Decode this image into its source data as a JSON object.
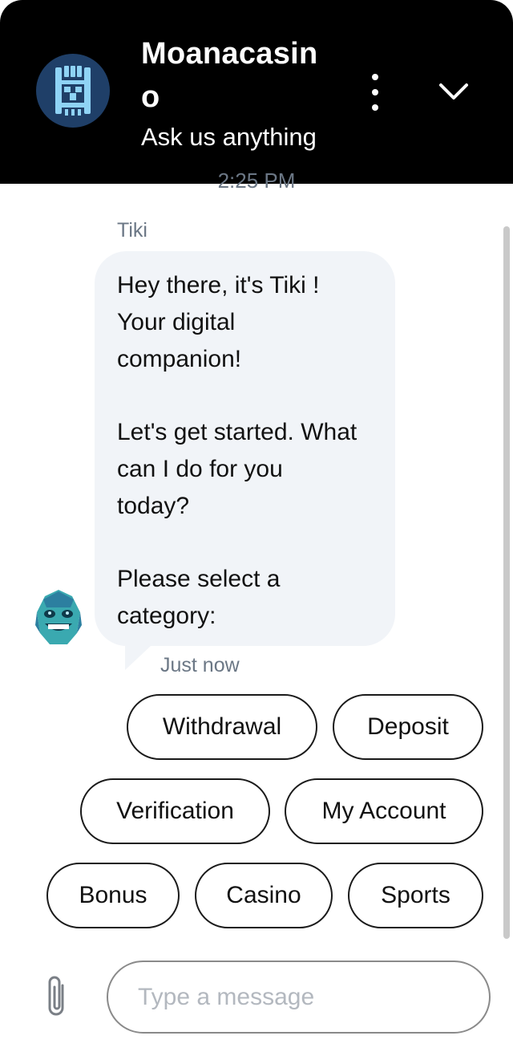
{
  "header": {
    "title": "Moanacasino",
    "subtitle": "Ask us anything"
  },
  "icons": {
    "logo": "tiki-mask-logo",
    "menu": "more-vertical-icon",
    "collapse": "chevron-down-icon",
    "avatar": "tiki-avatar-icon",
    "attach": "paperclip-icon"
  },
  "colors": {
    "header_bg": "#000000",
    "bubble_bg": "#f1f4f8",
    "logo_bg": "#1f3f68",
    "meta_text": "#6b7785"
  },
  "conversation": {
    "partial_timestamp": "2:25 PM",
    "sender": "Tiki",
    "message_lines": {
      "l1": "Hey there, it's Tiki !",
      "l2": "Your digital",
      "l3": "companion!",
      "l4": "Let's get started. What",
      "l5": "can I do for you",
      "l6": "today?",
      "l7": "Please select a",
      "l8": "category:"
    },
    "message_time": "Just now"
  },
  "quick_replies": [
    "Withdrawal",
    "Deposit",
    "Verification",
    "My Account",
    "Bonus",
    "Casino",
    "Sports"
  ],
  "composer": {
    "placeholder": "Type a message",
    "value": ""
  }
}
